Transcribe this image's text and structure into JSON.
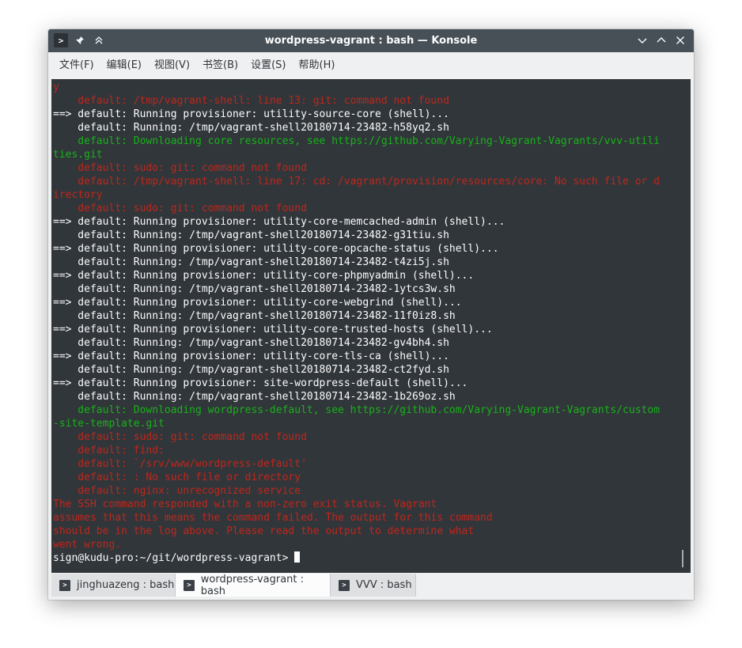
{
  "window": {
    "title": "wordpress-vagrant : bash — Konsole"
  },
  "menu": [
    "文件(F)",
    "编辑(E)",
    "视图(V)",
    "书签(B)",
    "设置(S)",
    "帮助(H)"
  ],
  "terminal": {
    "lines": [
      {
        "text": "y",
        "color": "red"
      },
      {
        "text": "    default: /tmp/vagrant-shell: line 13: git: command not found",
        "color": "red"
      },
      {
        "text": "==> default: Running provisioner: utility-source-core (shell)...",
        "color": "white"
      },
      {
        "text": "    default: Running: /tmp/vagrant-shell20180714-23482-h58yq2.sh",
        "color": "white"
      },
      {
        "text": "    default: Downloading core resources, see https://github.com/Varying-Vagrant-Vagrants/vvv-utili",
        "color": "green"
      },
      {
        "text": "ties.git",
        "color": "green"
      },
      {
        "text": "    default: sudo: git: command not found",
        "color": "red"
      },
      {
        "text": "    default: /tmp/vagrant-shell: line 17: cd: /vagrant/provision/resources/core: No such file or d",
        "color": "red"
      },
      {
        "text": "irectory",
        "color": "red"
      },
      {
        "text": "    default: sudo: git: command not found",
        "color": "red"
      },
      {
        "text": "==> default: Running provisioner: utility-core-memcached-admin (shell)...",
        "color": "white"
      },
      {
        "text": "    default: Running: /tmp/vagrant-shell20180714-23482-g31tiu.sh",
        "color": "white"
      },
      {
        "text": "==> default: Running provisioner: utility-core-opcache-status (shell)...",
        "color": "white"
      },
      {
        "text": "    default: Running: /tmp/vagrant-shell20180714-23482-t4zi5j.sh",
        "color": "white"
      },
      {
        "text": "==> default: Running provisioner: utility-core-phpmyadmin (shell)...",
        "color": "white"
      },
      {
        "text": "    default: Running: /tmp/vagrant-shell20180714-23482-1ytcs3w.sh",
        "color": "white"
      },
      {
        "text": "==> default: Running provisioner: utility-core-webgrind (shell)...",
        "color": "white"
      },
      {
        "text": "    default: Running: /tmp/vagrant-shell20180714-23482-11f0iz8.sh",
        "color": "white"
      },
      {
        "text": "==> default: Running provisioner: utility-core-trusted-hosts (shell)...",
        "color": "white"
      },
      {
        "text": "    default: Running: /tmp/vagrant-shell20180714-23482-gv4bh4.sh",
        "color": "white"
      },
      {
        "text": "==> default: Running provisioner: utility-core-tls-ca (shell)...",
        "color": "white"
      },
      {
        "text": "    default: Running: /tmp/vagrant-shell20180714-23482-ct2fyd.sh",
        "color": "white"
      },
      {
        "text": "==> default: Running provisioner: site-wordpress-default (shell)...",
        "color": "white"
      },
      {
        "text": "    default: Running: /tmp/vagrant-shell20180714-23482-1b269oz.sh",
        "color": "white"
      },
      {
        "text": "    default: Downloading wordpress-default, see https://github.com/Varying-Vagrant-Vagrants/custom",
        "color": "green"
      },
      {
        "text": "-site-template.git",
        "color": "green"
      },
      {
        "text": "    default: sudo: git: command not found",
        "color": "red"
      },
      {
        "text": "    default: find:",
        "color": "red"
      },
      {
        "text": "    default: `/srv/www/wordpress-default'",
        "color": "red"
      },
      {
        "text": "    default: : No such file or directory",
        "color": "red"
      },
      {
        "text": "    default: nginx: unrecognized service",
        "color": "red"
      },
      {
        "text": "The SSH command responded with a non-zero exit status. Vagrant",
        "color": "red"
      },
      {
        "text": "assumes that this means the command failed. The output for this command",
        "color": "red"
      },
      {
        "text": "should be in the log above. Please read the output to determine what",
        "color": "red"
      },
      {
        "text": "went wrong.",
        "color": "red"
      }
    ],
    "prompt": "sign@kudu-pro:~/git/wordpress-vagrant> "
  },
  "tabs": [
    {
      "label": "jinghuazeng : bash",
      "active": false
    },
    {
      "label": "wordpress-vagrant : bash",
      "active": true
    },
    {
      "label": "VVV : bash",
      "active": false
    }
  ],
  "colors": {
    "titlebar": "#475057",
    "terminal_bg": "#31363b",
    "text_white": "#fcfcfc",
    "text_red": "#c0261a",
    "text_green": "#18b218"
  }
}
